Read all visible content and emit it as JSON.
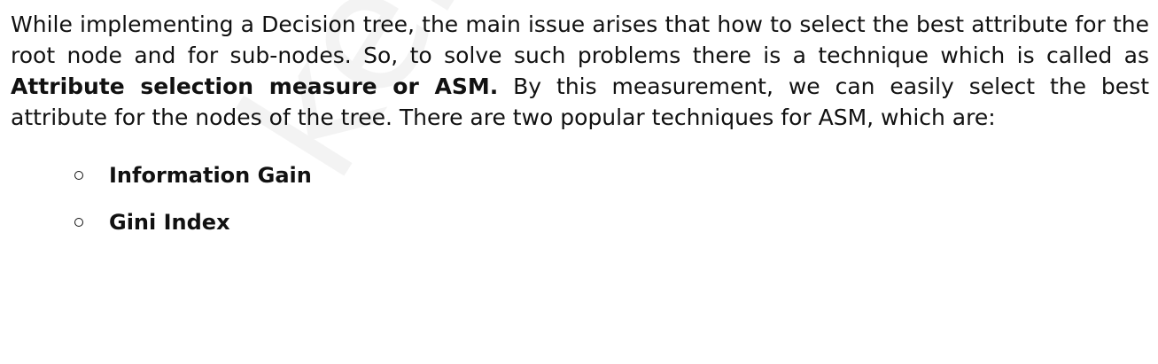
{
  "watermark": {
    "text": "keralanotes"
  },
  "paragraph": {
    "lead": "While implementing a Decision tree, the main issue arises that how to select the best attribute for the root node and for sub-nodes. So, to solve such problems there is a technique which is called as ",
    "highlight": "Attribute selection measure or ASM.",
    "tail": " By this measurement, we can easily select the best attribute for the nodes of the tree. There are two popular techniques for ASM, which are:"
  },
  "techniques": [
    {
      "label": "Information Gain",
      "bullet_icon": "hollow-circle-bullet"
    },
    {
      "label": "Gini Index",
      "bullet_icon": "hollow-circle-bullet"
    }
  ]
}
